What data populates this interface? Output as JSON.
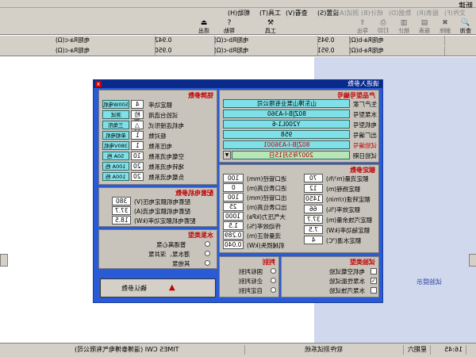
{
  "window": {
    "title": "新建"
  },
  "menu": [
    "查看(V)",
    "设置(S)",
    "工具(T)",
    "帮助(H)",
    "测试(A)",
    "统计(B)",
    "数据(D)",
    "报表(R)",
    "文件(F)"
  ],
  "toolbar": {
    "buttons": [
      "查询",
      "删除",
      "报表",
      "统计",
      "打印",
      "导出",
      "工具",
      "帮助",
      "退出"
    ],
    "help_label": "帮助",
    "exit_label": "退出",
    "tools_label": "工具"
  },
  "header": {
    "row1": [
      "电阻Ra-b(Ω)",
      "0.945",
      "电阻Rb-c(Ω)",
      "0.942",
      "电阻Ra-c(Ω)"
    ],
    "row2": [
      "电阻Ra-b(Ω)",
      "0.951",
      "电阻Rb-c(Ω)",
      "0.950",
      "电阻Ra-c(Ω)"
    ]
  },
  "dialog": {
    "title": "请进入参数",
    "motor_group": {
      "title": "铭牌参数",
      "fields": [
        {
          "label": "额定功率",
          "value": "4",
          "unit": "500W电机"
        },
        {
          "label": "试验台选用",
          "value": "检测台",
          "unit": "测试"
        },
        {
          "label": "电机连接形式",
          "value": "△",
          "unit": "三角形"
        },
        {
          "label": "极对数",
          "value": "1",
          "unit": "单相电机"
        },
        {
          "label": "电压系数",
          "value": "1",
          "unit": "380V电机"
        },
        {
          "label": "空载电流系数",
          "value": "10",
          "unit": "50A 档"
        },
        {
          "label": "堵转电流系数",
          "value": "20",
          "unit": "100A 档"
        },
        {
          "label": "负载电流系数",
          "value": "20",
          "unit": "100A 档"
        }
      ]
    },
    "product_group": {
      "title": "产品型号编号",
      "company": "山东博山泵业有限公司",
      "pump_model": "80ZJB-I-A360",
      "motor_model": "Y200L1-6",
      "serial": "958",
      "test_no": "80ZJB-I-A36001",
      "date": "2007年5月15日",
      "labels": [
        "生产厂家",
        "水泵型号",
        "电机型号",
        "出厂编号",
        "试验编号",
        "试验日期"
      ]
    },
    "matched_group": {
      "title": "配套电机参数",
      "fields": [
        {
          "label": "配套电机额定电压(V)",
          "value": "380"
        },
        {
          "label": "配套电机额定电流(A)",
          "value": "37.7"
        },
        {
          "label": "配套电机额定功率(kW)",
          "value": "18.5"
        }
      ]
    },
    "rated_group": {
      "title": "额定参数",
      "left": [
        {
          "label": "额定流量(m³/h)",
          "value": "70"
        },
        {
          "label": "额定扬程(m)",
          "value": "12"
        },
        {
          "label": "额定转速(r/min)",
          "value": "1450"
        },
        {
          "label": "额定效率(%)",
          "value": "66"
        },
        {
          "label": "额定汽蚀余量(m)",
          "value": "37.7"
        },
        {
          "label": "额定轴功率(kW)",
          "value": "7.5"
        },
        {
          "label": "额定水温(℃)",
          "value": "4"
        }
      ],
      "right": [
        {
          "label": "进口管径(mm)",
          "value": "100"
        },
        {
          "label": "进口表位高(m)",
          "value": "0"
        },
        {
          "label": "出口管径(mm)",
          "value": "100"
        },
        {
          "label": "出口表位高(m)",
          "value": "25"
        },
        {
          "label": "大气压力(kPa)",
          "value": "1000"
        },
        {
          "label": "传动效率(%)",
          "value": "1.5"
        },
        {
          "label": "流量修正(m)",
          "value": "0.289"
        },
        {
          "label": "机械损失(kW)",
          "value": "0.040"
        }
      ]
    },
    "pump_type_group": {
      "title": "水泵类型",
      "options": [
        "普通离心泵",
        "潜水泵、深井泵",
        "其他泵"
      ]
    },
    "test_type_group": {
      "title": "试验类型",
      "options": [
        "电机空载试验",
        "水泵性能试验",
        "水泵汽蚀试验"
      ],
      "checked": [
        false,
        true,
        false
      ]
    },
    "judge_group": {
      "title": "判别",
      "options": [
        "国标判别",
        "企标判别",
        "自定判别"
      ]
    },
    "confirm_label": "确认参数"
  },
  "side_hint": "试验提示",
  "statusbar": {
    "time": "16:45",
    "weekday": "星期六",
    "product": "软件测试系统",
    "company": "TIMES CWI (淄博泰博电气有限公司)"
  }
}
